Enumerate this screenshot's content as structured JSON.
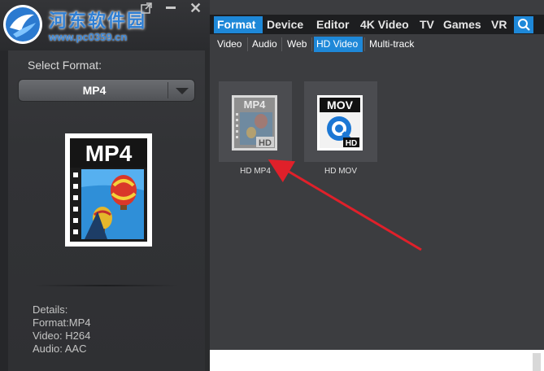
{
  "watermark": {
    "site_name": "河东软件园",
    "site_url": "www.pc0359.cn"
  },
  "window": {
    "close_glyph": "✕"
  },
  "left_panel": {
    "select_label": "Select Format:",
    "selected_format": "MP4",
    "preview_badge": "MP4",
    "details": {
      "heading": "Details:",
      "format": "Format:MP4",
      "video": "Video: H264",
      "audio": "Audio: AAC"
    }
  },
  "tabs": [
    {
      "label": "Format",
      "active": true
    },
    {
      "label": "Device",
      "active": false
    },
    {
      "label": "Editor",
      "active": false
    },
    {
      "label": "4K Video",
      "active": false
    },
    {
      "label": "TV",
      "active": false
    },
    {
      "label": "Games",
      "active": false
    },
    {
      "label": "VR",
      "active": false
    }
  ],
  "subtabs": [
    {
      "label": "Video",
      "active": false
    },
    {
      "label": "Audio",
      "active": false
    },
    {
      "label": "Web",
      "active": false
    },
    {
      "label": "HD Video",
      "active": true
    },
    {
      "label": "Multi-track",
      "active": false
    }
  ],
  "formats": [
    {
      "label": "HD MP4",
      "badge": "MP4",
      "hd": "HD",
      "icon": "mp4-film-icon"
    },
    {
      "label": "HD MOV",
      "badge": "MOV",
      "hd": "HD",
      "icon": "quicktime-icon"
    }
  ],
  "colors": {
    "accent": "#1e88d8",
    "annotation_arrow": "#e0202a"
  }
}
